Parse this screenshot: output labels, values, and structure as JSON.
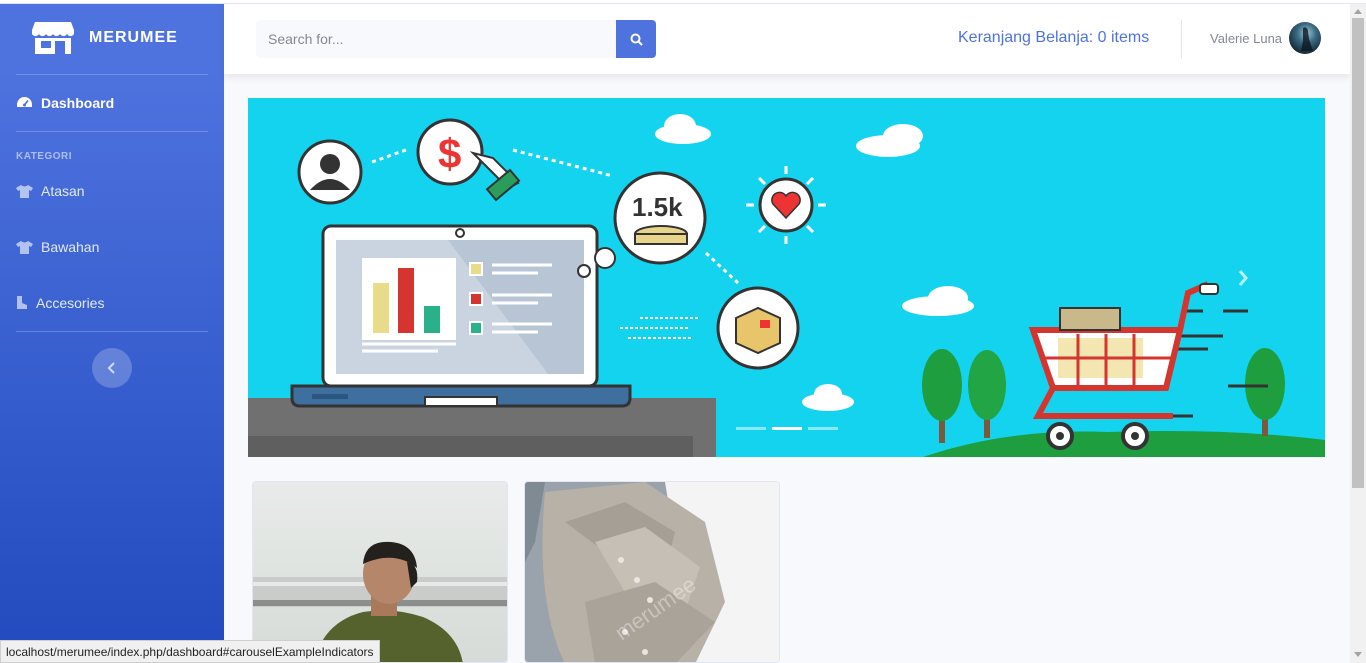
{
  "brand": {
    "name": "MERUMEE",
    "icon": "store-icon"
  },
  "sidebar": {
    "dashboard": {
      "label": "Dashboard",
      "icon": "tachometer-icon"
    },
    "heading": "KATEGORI",
    "items": [
      {
        "label": "Atasan",
        "icon": "tshirt-icon"
      },
      {
        "label": "Bawahan",
        "icon": "tshirt-icon"
      },
      {
        "label": "Accesories",
        "icon": "shoe-icon"
      }
    ],
    "toggle_icon": "chevron-left-icon"
  },
  "topbar": {
    "search_placeholder": "Search for...",
    "search_icon": "search-icon",
    "cart_text": "Keranjang Belanja: 0 items",
    "user_name": "Valerie Luna"
  },
  "carousel": {
    "badge_text": "1.5k",
    "dollar_text": "$",
    "slides": 3,
    "active_slide": 2
  },
  "products": [
    {
      "image": "man-in-green-shirt-photo"
    },
    {
      "image": "grey-shirts-photo",
      "watermark": "merumee"
    }
  ],
  "status_url": "localhost/merumee/index.php/dashboard#carouselExampleIndicators",
  "colors": {
    "primary": "#4e73df",
    "carousel_bg": "#14d3ee"
  }
}
